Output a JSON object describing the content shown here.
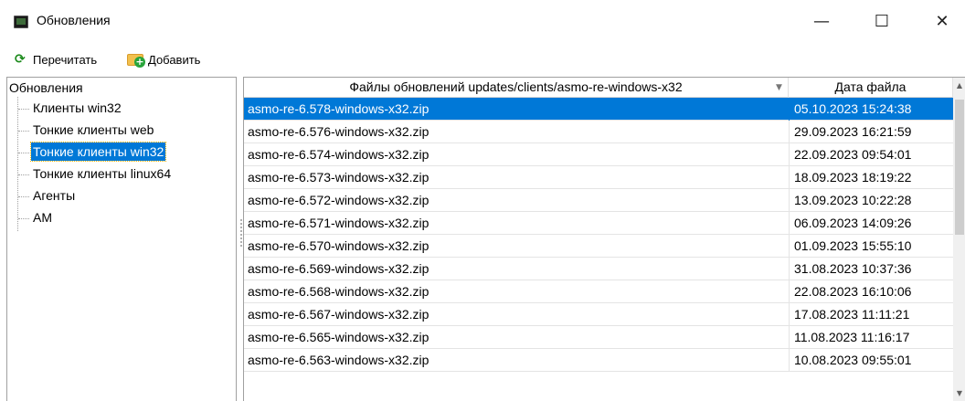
{
  "window": {
    "title": "Обновления",
    "icon": "monitor-icon",
    "minimize_glyph": "—",
    "maximize_glyph": "☐",
    "close_glyph": "✕"
  },
  "toolbar": {
    "refresh_label": "Перечитать",
    "refresh_icon": "refresh-icon",
    "add_label": "Добавить",
    "add_icon": "folder-add-icon"
  },
  "tree": {
    "root_label": "Обновления",
    "items": [
      {
        "label": "Клиенты win32",
        "selected": false
      },
      {
        "label": "Тонкие клиенты web",
        "selected": false
      },
      {
        "label": "Тонкие клиенты win32",
        "selected": true
      },
      {
        "label": "Тонкие клиенты linux64",
        "selected": false
      },
      {
        "label": "Агенты",
        "selected": false
      },
      {
        "label": "AM",
        "selected": false
      }
    ]
  },
  "grid": {
    "headers": {
      "file": "Файлы обновлений updates/clients/asmo-re-windows-x32",
      "date": "Дата файла"
    },
    "sort_indicator": "▼",
    "rows": [
      {
        "file": "asmo-re-6.578-windows-x32.zip",
        "date": "05.10.2023 15:24:38",
        "selected": true
      },
      {
        "file": "asmo-re-6.576-windows-x32.zip",
        "date": "29.09.2023 16:21:59",
        "selected": false
      },
      {
        "file": "asmo-re-6.574-windows-x32.zip",
        "date": "22.09.2023 09:54:01",
        "selected": false
      },
      {
        "file": "asmo-re-6.573-windows-x32.zip",
        "date": "18.09.2023 18:19:22",
        "selected": false
      },
      {
        "file": "asmo-re-6.572-windows-x32.zip",
        "date": "13.09.2023 10:22:28",
        "selected": false
      },
      {
        "file": "asmo-re-6.571-windows-x32.zip",
        "date": "06.09.2023 14:09:26",
        "selected": false
      },
      {
        "file": "asmo-re-6.570-windows-x32.zip",
        "date": "01.09.2023 15:55:10",
        "selected": false
      },
      {
        "file": "asmo-re-6.569-windows-x32.zip",
        "date": "31.08.2023 10:37:36",
        "selected": false
      },
      {
        "file": "asmo-re-6.568-windows-x32.zip",
        "date": "22.08.2023 16:10:06",
        "selected": false
      },
      {
        "file": "asmo-re-6.567-windows-x32.zip",
        "date": "17.08.2023 11:11:21",
        "selected": false
      },
      {
        "file": "asmo-re-6.565-windows-x32.zip",
        "date": "11.08.2023 11:16:17",
        "selected": false
      },
      {
        "file": "asmo-re-6.563-windows-x32.zip",
        "date": "10.08.2023 09:55:01",
        "selected": false
      }
    ]
  },
  "scrollbar": {
    "up_glyph": "▲",
    "down_glyph": "▼"
  },
  "colors": {
    "selection": "#0078d7",
    "focus_outline": "#f5b400"
  }
}
